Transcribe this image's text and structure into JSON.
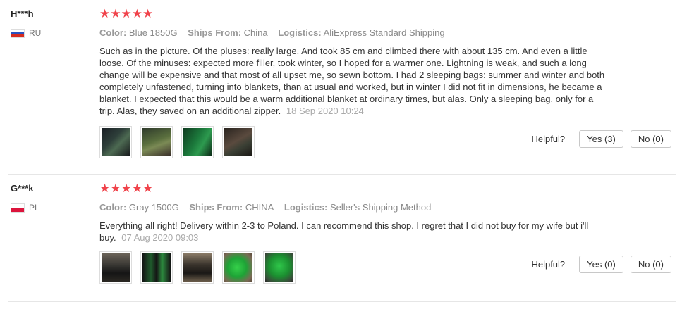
{
  "reviews": [
    {
      "user": "H***h",
      "country": "RU",
      "stars": "★★★★★",
      "color_label": "Color:",
      "color_value": "Blue 1850G",
      "ships_label": "Ships From:",
      "ships_value": "China",
      "logistics_label": "Logistics:",
      "logistics_value": "AliExpress Standard Shipping",
      "text": "Such as in the picture. Of the pluses: really large. And took 85 cm and climbed there with about 135 cm. And even a little loose. Of the minuses: expected more filler, took winter, so I hoped for a warmer one. Lightning is weak, and such a long change will be expensive and that most of all upset me, so sewn bottom. I had 2 sleeping bags: summer and winter and both completely unfastened, turning into blankets, than at usual and worked, but in winter I did not fit in dimensions, he became a blanket. I expected that this would be a warm additional blanket at ordinary times, but alas. Only a sleeping bag, only for a trip. Alas, they saved on an additional zipper.",
      "date": "18 Sep 2020 10:24",
      "helpful_label": "Helpful?",
      "yes_label": "Yes (3)",
      "no_label": "No (0)"
    },
    {
      "user": "G***k",
      "country": "PL",
      "stars": "★★★★★",
      "color_label": "Color:",
      "color_value": "Gray 1500G",
      "ships_label": "Ships From:",
      "ships_value": "CHINA",
      "logistics_label": "Logistics:",
      "logistics_value": "Seller's Shipping Method",
      "text": "Everything all right! Delivery within 2-3 to Poland. I can recommend this shop. I regret that I did not buy for my wife but i'll buy.",
      "date": "07 Aug 2020 09:03",
      "helpful_label": "Helpful?",
      "yes_label": "Yes (0)",
      "no_label": "No (0)"
    }
  ],
  "colors": {
    "star": "#f0434b",
    "flag_ru": [
      "#ffffff",
      "#2a52be",
      "#d52b1e"
    ],
    "flag_pl": [
      "#ffffff",
      "#dc143c"
    ]
  }
}
